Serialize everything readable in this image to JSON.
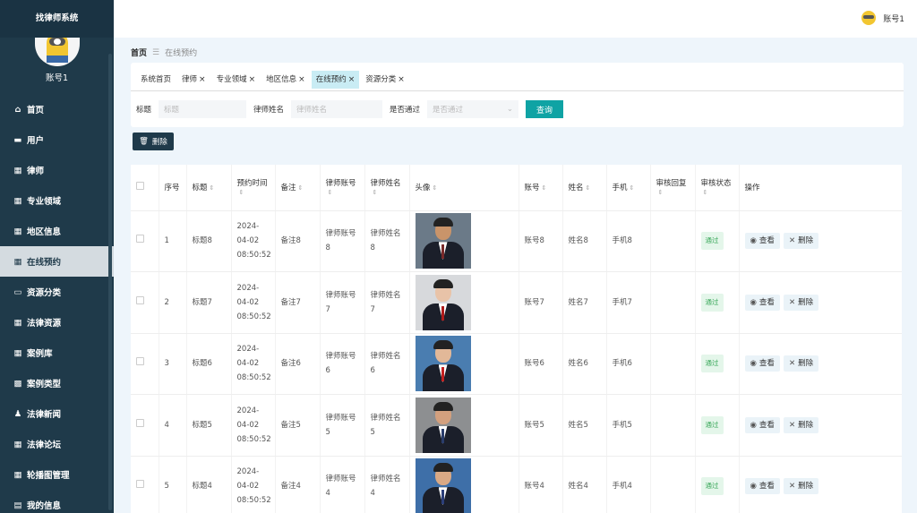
{
  "sidebar": {
    "title": "找律师系统",
    "username": "账号1",
    "items": [
      {
        "label": "首页",
        "icon": "home-icon"
      },
      {
        "label": "用户",
        "icon": "briefcase-icon"
      },
      {
        "label": "律师",
        "icon": "grid-icon"
      },
      {
        "label": "专业领域",
        "icon": "grid-icon"
      },
      {
        "label": "地区信息",
        "icon": "grid-icon"
      },
      {
        "label": "在线预约",
        "icon": "grid-icon",
        "active": true
      },
      {
        "label": "资源分类",
        "icon": "printer-icon"
      },
      {
        "label": "法律资源",
        "icon": "grid-icon"
      },
      {
        "label": "案例库",
        "icon": "grid-icon"
      },
      {
        "label": "案例类型",
        "icon": "apps-icon"
      },
      {
        "label": "法律新闻",
        "icon": "user-icon"
      },
      {
        "label": "法律论坛",
        "icon": "grid-icon"
      },
      {
        "label": "轮播图管理",
        "icon": "grid-icon"
      },
      {
        "label": "我的信息",
        "icon": "card-icon"
      }
    ]
  },
  "topbar": {
    "account": "账号1"
  },
  "breadcrumb": {
    "home": "首页",
    "separator": "☰",
    "current": "在线预约"
  },
  "tabs": [
    {
      "label": "系统首页",
      "closable": false
    },
    {
      "label": "律师",
      "closable": true
    },
    {
      "label": "专业领域",
      "closable": true
    },
    {
      "label": "地区信息",
      "closable": true
    },
    {
      "label": "在线预约",
      "closable": true,
      "active": true
    },
    {
      "label": "资源分类",
      "closable": true
    }
  ],
  "search": {
    "title_label": "标题",
    "title_placeholder": "标题",
    "lawyer_label": "律师姓名",
    "lawyer_placeholder": "律师姓名",
    "approved_label": "是否通过",
    "approved_placeholder": "是否通过",
    "query_button": "查询"
  },
  "toolbar": {
    "delete_label": "删除"
  },
  "table": {
    "headers": [
      "序号",
      "标题",
      "预约时间",
      "备注",
      "律师账号",
      "律师姓名",
      "头像",
      "账号",
      "姓名",
      "手机",
      "审核回复",
      "审核状态",
      "操作"
    ],
    "rows": [
      {
        "no": "1",
        "title": "标题8",
        "time": "2024-04-02 08:50:52",
        "remark": "备注8",
        "lawyer_acct": "律师账号8",
        "lawyer_name": "律师姓名8",
        "acct": "账号8",
        "name": "姓名8",
        "phone": "手机8",
        "reply": "",
        "status": "通过"
      },
      {
        "no": "2",
        "title": "标题7",
        "time": "2024-04-02 08:50:52",
        "remark": "备注7",
        "lawyer_acct": "律师账号7",
        "lawyer_name": "律师姓名7",
        "acct": "账号7",
        "name": "姓名7",
        "phone": "手机7",
        "reply": "",
        "status": "通过"
      },
      {
        "no": "3",
        "title": "标题6",
        "time": "2024-04-02 08:50:52",
        "remark": "备注6",
        "lawyer_acct": "律师账号6",
        "lawyer_name": "律师姓名6",
        "acct": "账号6",
        "name": "姓名6",
        "phone": "手机6",
        "reply": "",
        "status": "通过"
      },
      {
        "no": "4",
        "title": "标题5",
        "time": "2024-04-02 08:50:52",
        "remark": "备注5",
        "lawyer_acct": "律师账号5",
        "lawyer_name": "律师姓名5",
        "acct": "账号5",
        "name": "姓名5",
        "phone": "手机5",
        "reply": "",
        "status": "通过"
      },
      {
        "no": "5",
        "title": "标题4",
        "time": "2024-04-02 08:50:52",
        "remark": "备注4",
        "lawyer_acct": "律师账号4",
        "lawyer_name": "律师姓名4",
        "acct": "账号4",
        "name": "姓名4",
        "phone": "手机4",
        "reply": "",
        "status": "通过"
      }
    ],
    "view_label": "查看",
    "delete_label": "删除"
  },
  "colors": {
    "sidebar": "#1f3a4a",
    "accent": "#0fa3a4",
    "tab_active": "#c9ecf4",
    "status_green": "#3aa85a"
  }
}
